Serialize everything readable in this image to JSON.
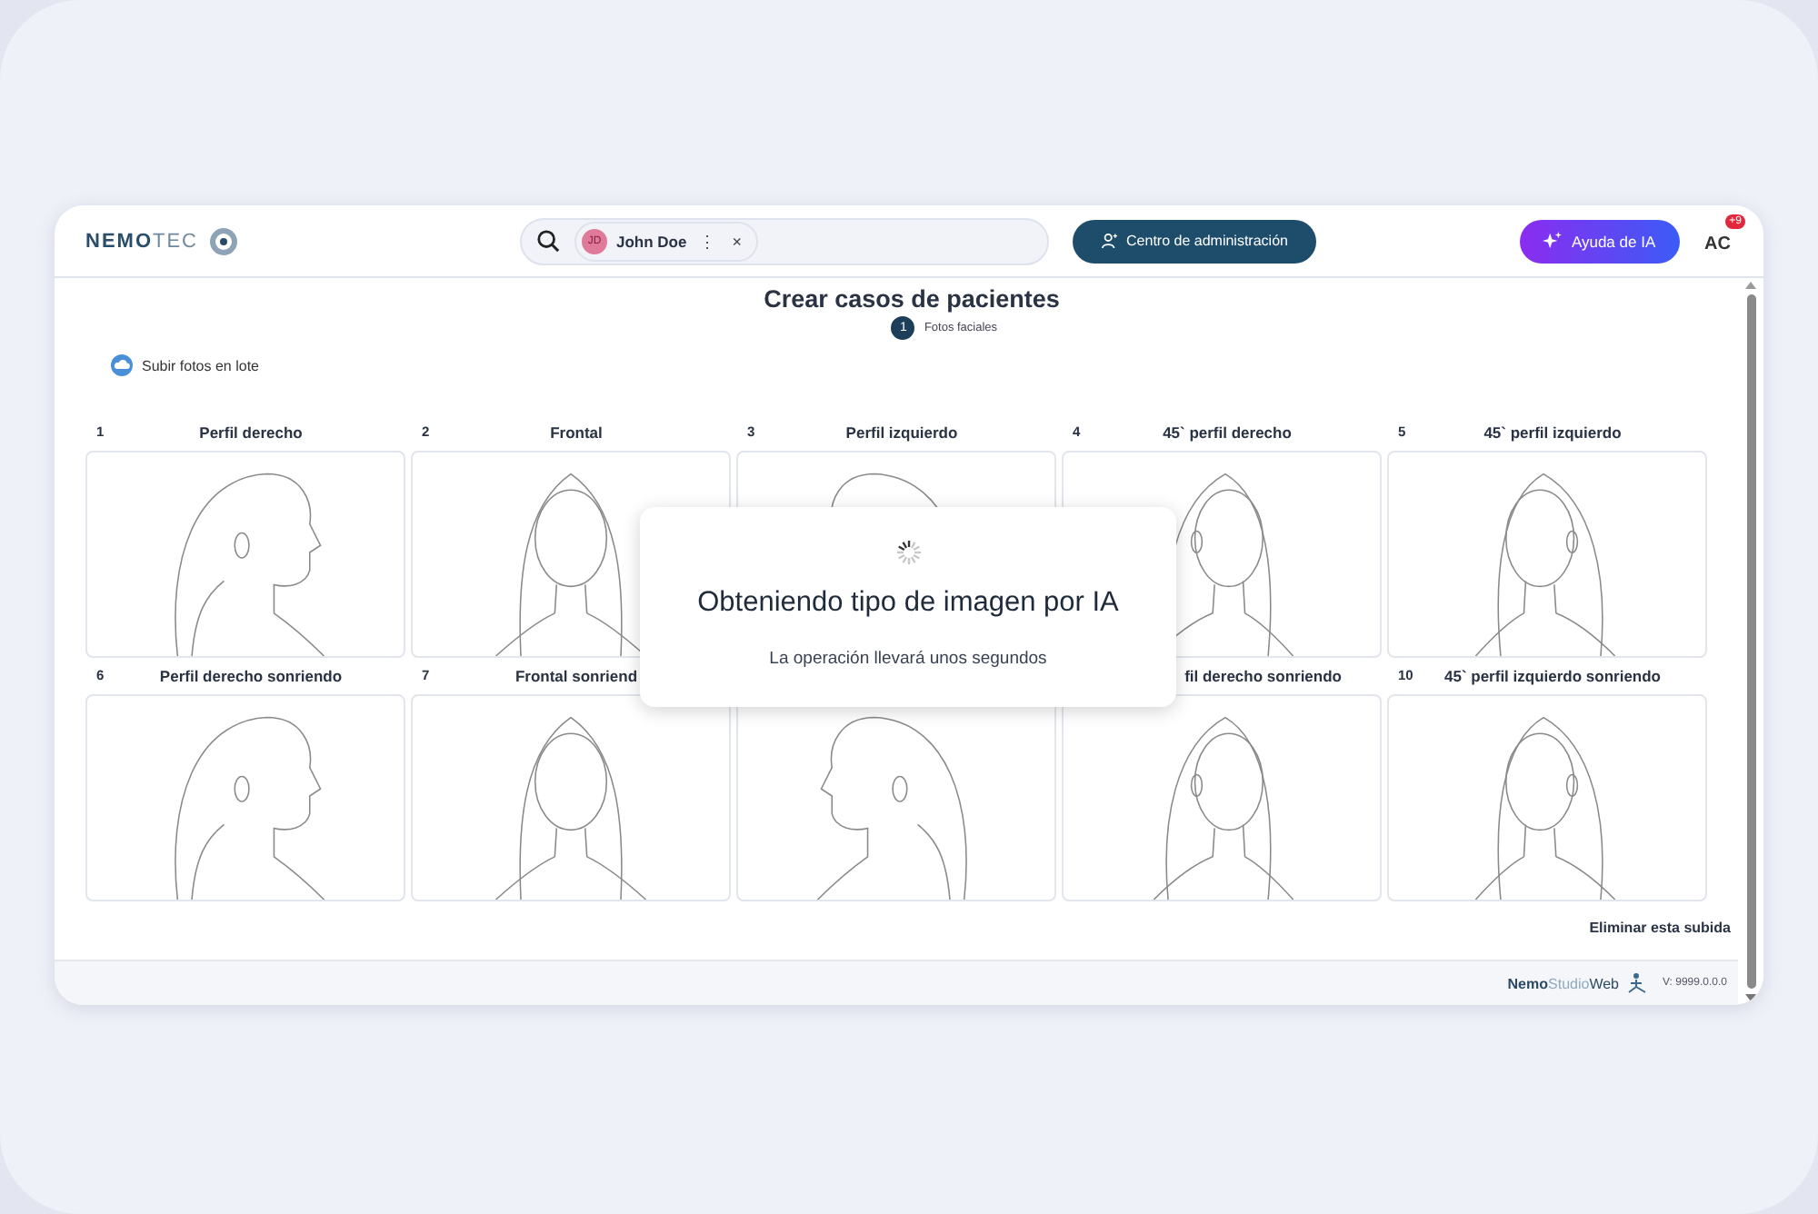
{
  "header": {
    "logo": {
      "strong": "NEMO",
      "light": "TEC"
    },
    "search": {
      "chip": {
        "initials": "JD",
        "name": "John Doe",
        "menu": "⋮",
        "remove": "×"
      }
    },
    "admin_button": "Centro de administración",
    "ai_button": "Ayuda de IA",
    "user": {
      "initials": "AC",
      "badge": "+9"
    }
  },
  "page": {
    "title": "Crear casos de pacientes",
    "steps": [
      {
        "number": "1",
        "label": "Fotos faciales",
        "selected": true
      }
    ],
    "upload_link": "Subir fotos en lote",
    "photos": [
      {
        "number": "1",
        "label": "Perfil derecho",
        "kind": "profile_right"
      },
      {
        "number": "2",
        "label": "Frontal",
        "kind": "front"
      },
      {
        "number": "3",
        "label": "Perfil izquierdo",
        "kind": "profile_left"
      },
      {
        "number": "4",
        "label": "45` perfil derecho",
        "kind": "turn_right"
      },
      {
        "number": "5",
        "label": "45` perfil izquierdo",
        "kind": "turn_left"
      },
      {
        "number": "6",
        "label": "Perfil derecho sonriendo",
        "kind": "profile_right"
      },
      {
        "number": "7",
        "label": "Frontal sonriend",
        "kind": "front"
      },
      {
        "kind": "profile_left"
      },
      {
        "label": "fil derecho sonriendo",
        "kind": "turn_right"
      },
      {
        "number": "10",
        "label": "45` perfil izquierdo sonriendo",
        "kind": "turn_left"
      }
    ],
    "delete_link": "Eliminar esta subida"
  },
  "modal": {
    "title": "Obteniendo tipo de imagen por IA",
    "message": "La operación llevará unos segundos"
  },
  "footer": {
    "brand": {
      "strong": "Nemo",
      "light": "Studio",
      "end": "Web"
    },
    "version": "V: 9999.0.0.0"
  }
}
